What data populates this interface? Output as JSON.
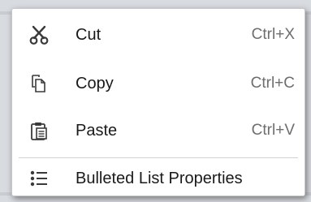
{
  "context_menu": {
    "items": [
      {
        "label": "Cut",
        "shortcut": "Ctrl+X",
        "icon": "scissors-icon"
      },
      {
        "label": "Copy",
        "shortcut": "Ctrl+C",
        "icon": "copy-icon"
      },
      {
        "label": "Paste",
        "shortcut": "Ctrl+V",
        "icon": "paste-icon"
      },
      {
        "label": "Bulleted List Properties",
        "shortcut": "",
        "icon": "bulleted-list-icon"
      }
    ]
  },
  "colors": {
    "menu_background": "#ffffff",
    "text": "#1a1a1a",
    "shortcut_text": "#6e6e6e",
    "icon": "#3a3a3a"
  }
}
